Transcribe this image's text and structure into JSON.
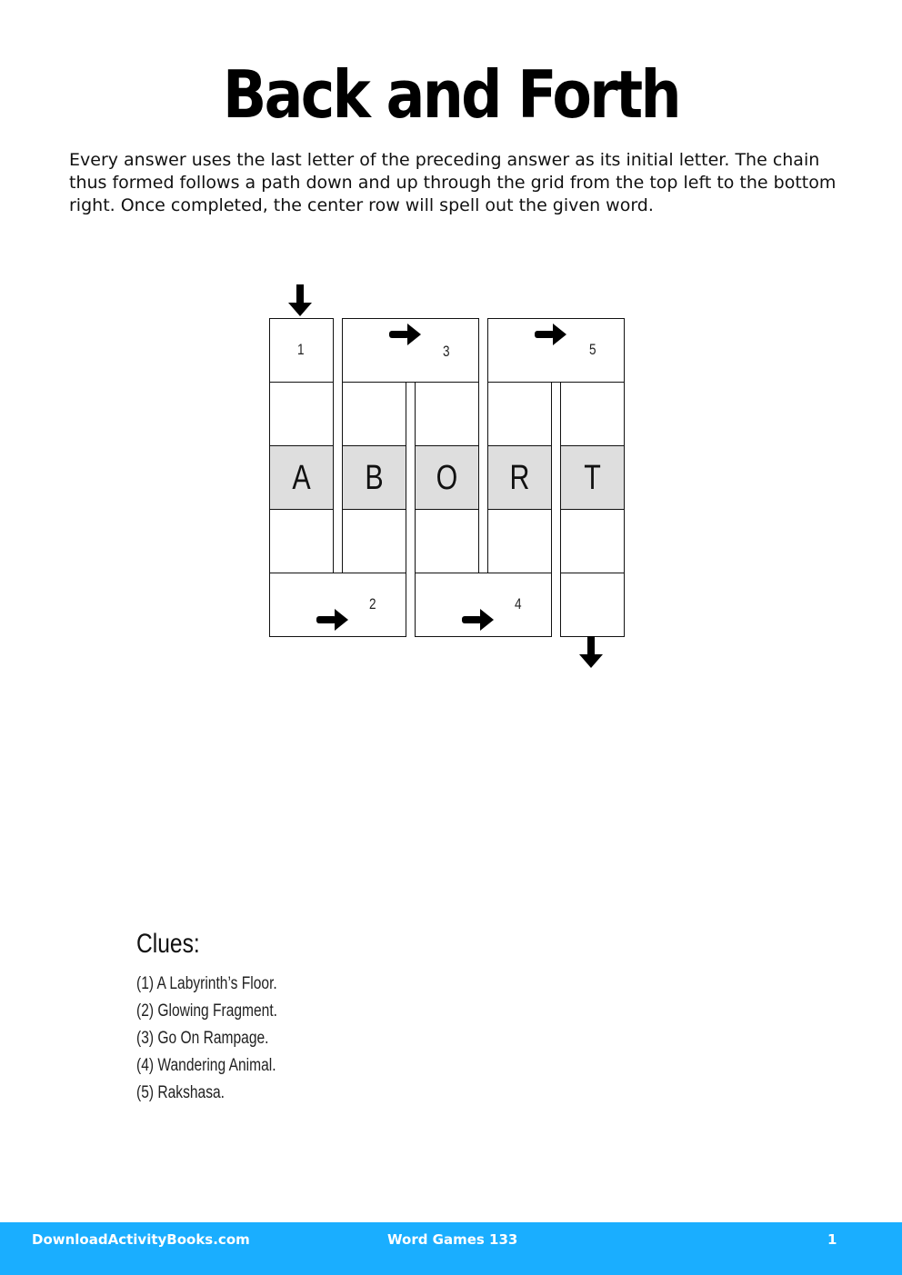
{
  "title": "Back and Forth",
  "instructions": "Every answer uses the last letter of the preceding answer as its initial letter. The chain thus formed follows a path down and up through the grid from the top left to the bottom right. Once completed, the center row will spell out the given word.",
  "puzzle": {
    "given_word": "ABORT",
    "clue_numbers": [
      "1",
      "2",
      "3",
      "4",
      "5"
    ],
    "center_letters": [
      "A",
      "B",
      "O",
      "R",
      "T"
    ],
    "start_arrow": "arrow-down",
    "end_arrow": "arrow-down",
    "shade_color": "#dedede"
  },
  "clues": {
    "heading": "Clues:",
    "items": [
      "(1) A Labyrinth’s Floor.",
      "(2) Glowing Fragment.",
      "(3) Go On Rampage.",
      "(4) Wandering Animal.",
      "(5) Rakshasa."
    ]
  },
  "footer": {
    "site": "DownloadActivityBooks.com",
    "book": "Word Games 133",
    "page": "1",
    "color": "#1aaeff"
  }
}
